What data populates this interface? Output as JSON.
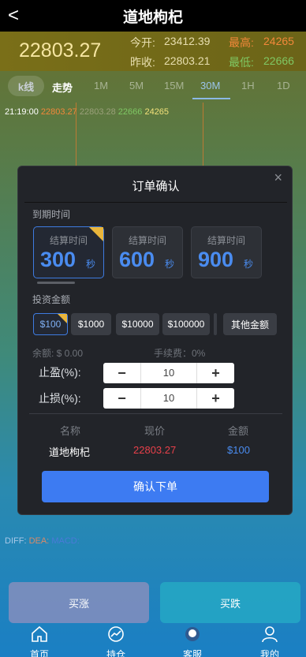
{
  "header": {
    "title": "道地枸杞",
    "back": "<"
  },
  "price": {
    "current": "22803.27",
    "open_label": "今开:",
    "open": "23412.39",
    "high_label": "最高:",
    "high": "24265",
    "prev_label": "昨收:",
    "prev": "22803.21",
    "low_label": "最低:",
    "low": "22666"
  },
  "tabs": {
    "kline": "k线",
    "trend": "走势",
    "items": [
      "1M",
      "5M",
      "15M",
      "30M",
      "1H",
      "1D"
    ],
    "selected": "30M"
  },
  "legend": {
    "time": "21:19:00",
    "v1": "22803.27",
    "v2": "22803.28",
    "v3": "22666",
    "v4": "24265"
  },
  "diff": {
    "diff": "DIFF:",
    "dea": "DEA:",
    "macd": "MACD:"
  },
  "modal": {
    "title": "订单确认",
    "close": "×",
    "expiry_label": "到期时间",
    "cards": [
      {
        "label": "结算时间",
        "num": "300",
        "unit": "秒",
        "selected": true
      },
      {
        "label": "结算时间",
        "num": "600",
        "unit": "秒",
        "selected": false
      },
      {
        "label": "结算时间",
        "num": "900",
        "unit": "秒",
        "selected": false
      }
    ],
    "amount_label": "投资金额",
    "amounts": [
      "$100",
      "$1000",
      "$10000",
      "$100000"
    ],
    "other_amount": "其他金额",
    "balance": "余额: $ 0.00",
    "fee": "手续费：0%",
    "take_profit_label": "止盈(%):",
    "take_profit": "10",
    "stop_loss_label": "止损(%):",
    "stop_loss": "10",
    "table": {
      "headers": [
        "名称",
        "现价",
        "金额"
      ],
      "name": "道地枸杞",
      "price": "22803.27",
      "amount": "$100"
    },
    "confirm": "确认下单"
  },
  "actions": {
    "buy_up": "买涨",
    "buy_down": "买跌"
  },
  "nav": [
    "首页",
    "持仓",
    "客服",
    "我的"
  ],
  "colors": {
    "up": "#f5953b",
    "down": "#6fc060",
    "accent": "#3d7bf2",
    "price_red": "#e8404a"
  }
}
